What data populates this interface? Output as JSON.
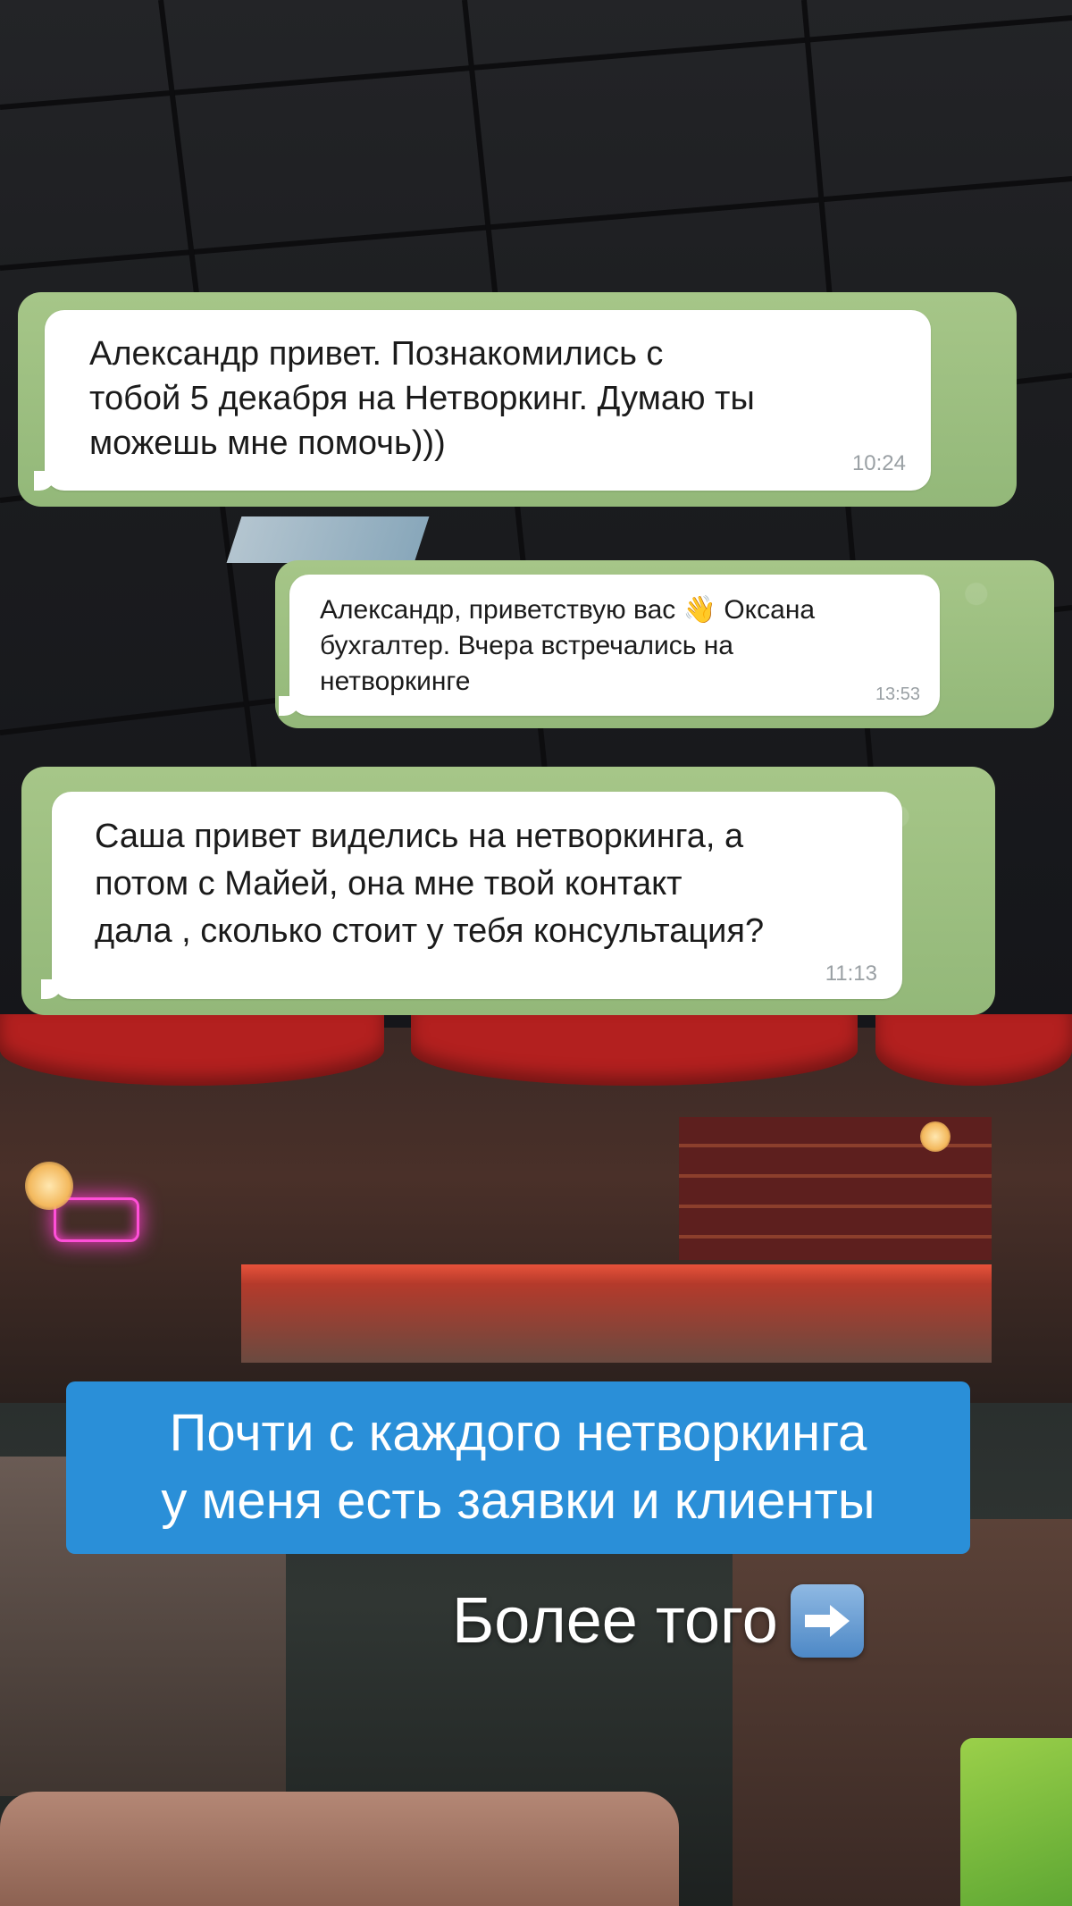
{
  "messages": [
    {
      "text": "Александр привет. Познакомились с\nтобой 5 декабря на Нетворкинг. Думаю ты\nможешь мне помочь)))",
      "time": "10:24"
    },
    {
      "text_before_icon": "Александр, приветствую вас ",
      "icon": "waving-hand-icon",
      "text_after_icon": " Оксана\nбухгалтер. Вчера встречались на\nнетворкинге",
      "time": "13:53"
    },
    {
      "text": "Саша привет виделись на нетворкинга, а\nпотом с Майей, она мне твой контакт\nдала , сколько стоит у тебя консультация?",
      "time": "11:13"
    }
  ],
  "caption": {
    "text": "Почти с каждого нетворкинга\nу меня есть заявки и клиенты",
    "background": "#2a8fd8"
  },
  "more": {
    "text": "Более того",
    "icon": "right-arrow-icon"
  },
  "colors": {
    "chat_background": "#9cbd80",
    "bubble": "#ffffff",
    "time": "#9aa0a4"
  }
}
